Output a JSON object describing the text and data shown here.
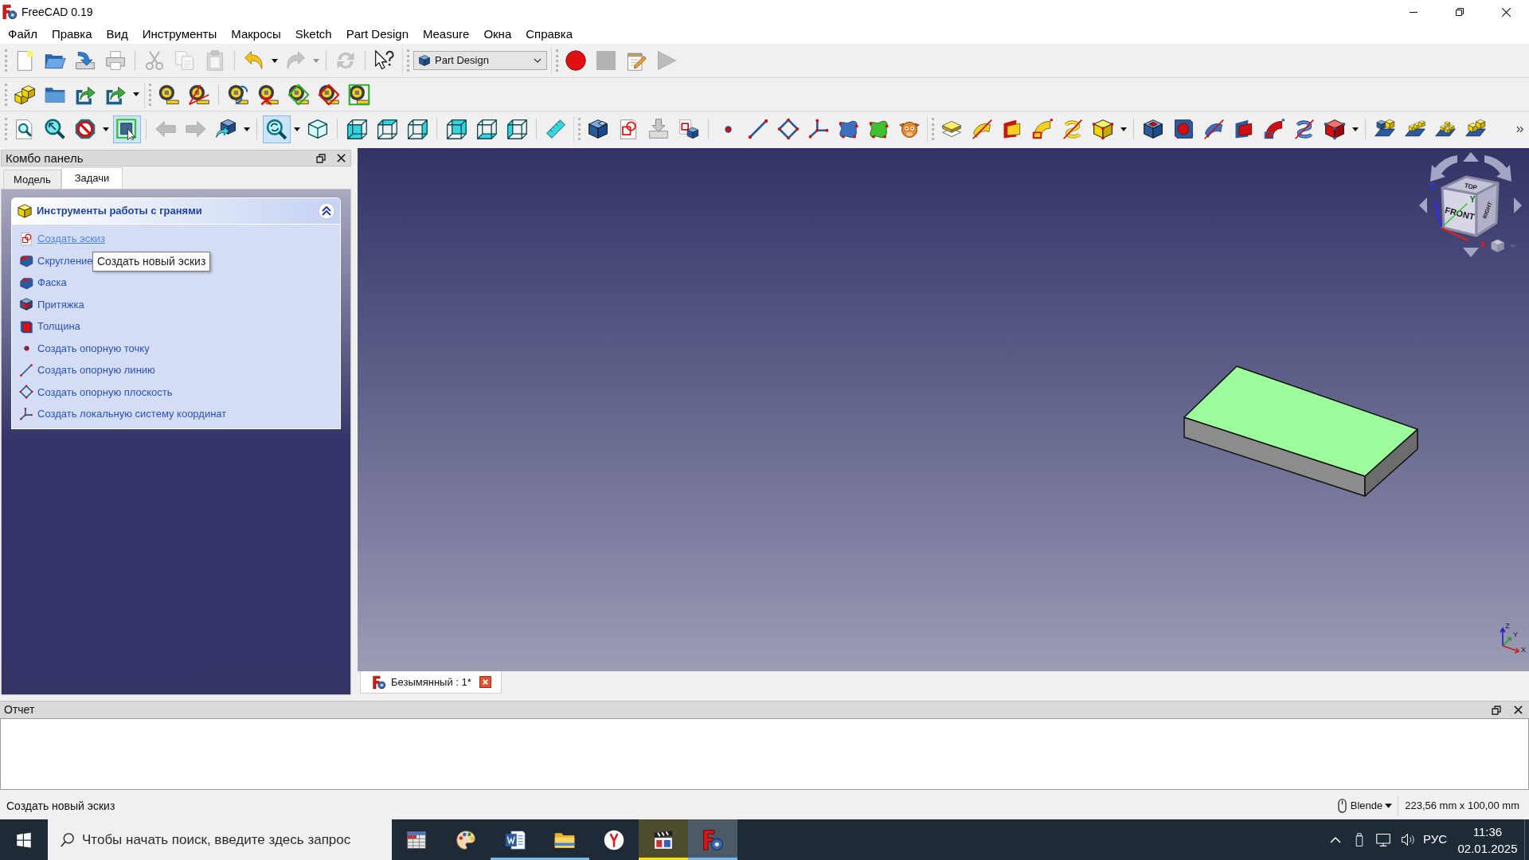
{
  "window": {
    "title": "FreeCAD 0.19"
  },
  "menu": [
    "Файл",
    "Правка",
    "Вид",
    "Инструменты",
    "Макросы",
    "Sketch",
    "Part Design",
    "Measure",
    "Окна",
    "Справка"
  ],
  "toolbar_rows": [
    [
      {
        "kind": "buttons",
        "buttons": [
          {
            "disabled": false,
            "checked": false
          },
          {
            "disabled": false,
            "checked": false
          },
          {
            "disabled": false,
            "checked": false
          },
          {
            "disabled": false,
            "checked": false
          }
        ]
      },
      {
        "kind": "buttons",
        "buttons": [
          {
            "disabled": true,
            "checked": false
          },
          {
            "disabled": true,
            "checked": false
          },
          {
            "disabled": true,
            "checked": false
          }
        ]
      },
      {
        "kind": "buttons",
        "buttons": [
          {
            "disabled": false,
            "checked": false
          },
          {
            "disabled": true,
            "checked": false
          }
        ]
      },
      {
        "kind": "buttons",
        "buttons": [
          {
            "disabled": true,
            "checked": false
          }
        ]
      },
      {
        "kind": "buttons",
        "buttons": [
          {
            "disabled": false,
            "checked": false
          }
        ]
      },
      {
        "kind": "combo",
        "value": "Part Design"
      },
      {
        "kind": "buttons",
        "buttons": [
          {
            "disabled": false,
            "checked": false
          },
          {
            "disabled": true,
            "checked": false
          },
          {
            "disabled": false,
            "checked": false
          },
          {
            "disabled": true,
            "checked": false
          }
        ]
      }
    ],
    [
      {
        "kind": "buttons",
        "buttons": [
          {
            "disabled": false,
            "checked": false
          },
          {
            "disabled": false,
            "checked": false
          },
          {
            "disabled": false,
            "checked": false
          },
          {
            "disabled": false,
            "checked": false
          }
        ]
      },
      {
        "kind": "buttons",
        "buttons": [
          {
            "disabled": false,
            "checked": false
          },
          {
            "disabled": false,
            "checked": false
          }
        ]
      },
      {
        "kind": "buttons",
        "buttons": [
          {
            "disabled": false,
            "checked": false
          },
          {
            "disabled": false,
            "checked": false
          },
          {
            "disabled": false,
            "checked": false
          },
          {
            "disabled": false,
            "checked": false
          },
          {
            "disabled": false,
            "checked": false
          }
        ]
      }
    ],
    [
      {
        "kind": "buttons",
        "buttons": [
          {
            "disabled": false,
            "checked": false
          },
          {
            "disabled": false,
            "checked": false
          },
          {
            "disabled": false,
            "checked": false
          },
          {
            "disabled": false,
            "checked": true
          }
        ]
      },
      {
        "kind": "buttons",
        "buttons": [
          {
            "disabled": true,
            "checked": false
          },
          {
            "disabled": true,
            "checked": false
          },
          {
            "disabled": false,
            "checked": false
          }
        ]
      },
      {
        "kind": "buttons",
        "buttons": [
          {
            "disabled": false,
            "checked": true
          },
          {
            "disabled": false,
            "checked": false
          }
        ]
      },
      {
        "kind": "buttons",
        "buttons": [
          {
            "disabled": false,
            "checked": false
          },
          {
            "disabled": false,
            "checked": false
          },
          {
            "disabled": false,
            "checked": false
          }
        ]
      },
      {
        "kind": "buttons",
        "buttons": [
          {
            "disabled": false,
            "checked": false
          },
          {
            "disabled": false,
            "checked": false
          },
          {
            "disabled": false,
            "checked": false
          }
        ]
      },
      {
        "kind": "buttons",
        "buttons": [
          {
            "disabled": false,
            "checked": false
          }
        ]
      },
      {
        "kind": "buttons",
        "buttons": [
          {
            "disabled": false,
            "checked": false
          },
          {
            "disabled": false,
            "checked": false
          },
          {
            "disabled": false,
            "checked": false
          },
          {
            "disabled": false,
            "checked": false
          }
        ]
      },
      {
        "kind": "buttons",
        "buttons": [
          {
            "disabled": false,
            "checked": false
          },
          {
            "disabled": false,
            "checked": false
          },
          {
            "disabled": false,
            "checked": false
          },
          {
            "disabled": false,
            "checked": false
          },
          {
            "disabled": false,
            "checked": false
          },
          {
            "disabled": false,
            "checked": false
          },
          {
            "disabled": false,
            "checked": false
          }
        ]
      },
      {
        "kind": "buttons",
        "buttons": [
          {
            "disabled": false,
            "checked": false
          },
          {
            "disabled": false,
            "checked": false
          },
          {
            "disabled": false,
            "checked": false
          },
          {
            "disabled": false,
            "checked": false
          },
          {
            "disabled": false,
            "checked": false
          },
          {
            "disabled": false,
            "checked": false
          }
        ]
      },
      {
        "kind": "buttons",
        "buttons": [
          {
            "disabled": false,
            "checked": false
          },
          {
            "disabled": false,
            "checked": false
          },
          {
            "disabled": false,
            "checked": false
          },
          {
            "disabled": false,
            "checked": false
          },
          {
            "disabled": false,
            "checked": false
          },
          {
            "disabled": false,
            "checked": false
          },
          {
            "disabled": false,
            "checked": false
          }
        ]
      },
      {
        "kind": "buttons",
        "buttons": [
          {
            "disabled": false,
            "checked": false
          },
          {
            "disabled": false,
            "checked": false
          },
          {
            "disabled": false,
            "checked": false
          },
          {
            "disabled": false,
            "checked": false
          }
        ]
      }
    ]
  ],
  "combo_panel": {
    "title": "Комбо панель",
    "tabs": [
      {
        "label": "Модель",
        "selected": false
      },
      {
        "label": "Задачи",
        "selected": true
      }
    ],
    "task_box": {
      "title": "Инструменты работы с гранями",
      "expanded": true,
      "items": [
        {
          "label": "Создать эскиз",
          "hovered": true
        },
        {
          "label": "Скругление",
          "hovered": false
        },
        {
          "label": "Фаска",
          "hovered": false
        },
        {
          "label": "Притяжка",
          "hovered": false
        },
        {
          "label": "Толщина",
          "hovered": false
        },
        {
          "label": "Создать опорную точку",
          "hovered": false
        },
        {
          "label": "Создать опорную линию",
          "hovered": false
        },
        {
          "label": "Создать опорную плоскость",
          "hovered": false
        },
        {
          "label": "Создать локальную систему координат",
          "hovered": false
        }
      ]
    }
  },
  "tooltip": {
    "text": "Создать новый эскиз"
  },
  "viewport": {
    "navigation_cube": {
      "faces": [
        "TOP",
        "FRONT",
        "RIGHT"
      ],
      "axis_labels": [
        "Z",
        "Y",
        "X"
      ]
    },
    "axis_cross": {
      "labels": [
        "Z",
        "Y",
        "X"
      ]
    }
  },
  "document_tabs": [
    {
      "label": "Безымянный : 1*",
      "selected": true
    }
  ],
  "report": {
    "title": "Отчет"
  },
  "status_bar": {
    "message": "Создать новый эскиз",
    "navigation_style": "Blende",
    "dimensions": "223,56 mm x 100,00 mm"
  },
  "taskbar": {
    "search": {
      "placeholder": "Чтобы начать поиск, введите здесь запрос"
    },
    "apps": [
      {
        "running": false,
        "active": false,
        "flashing": false
      },
      {
        "running": false,
        "active": false,
        "flashing": false
      },
      {
        "running": true,
        "active": false,
        "flashing": false
      },
      {
        "running": true,
        "active": false,
        "flashing": false
      },
      {
        "running": false,
        "active": false,
        "flashing": false
      },
      {
        "running": true,
        "active": false,
        "flashing": true
      },
      {
        "running": true,
        "active": true,
        "flashing": false
      }
    ],
    "tray": {
      "language": "РУС",
      "time": "11:36",
      "date": "02.01.2025"
    }
  }
}
